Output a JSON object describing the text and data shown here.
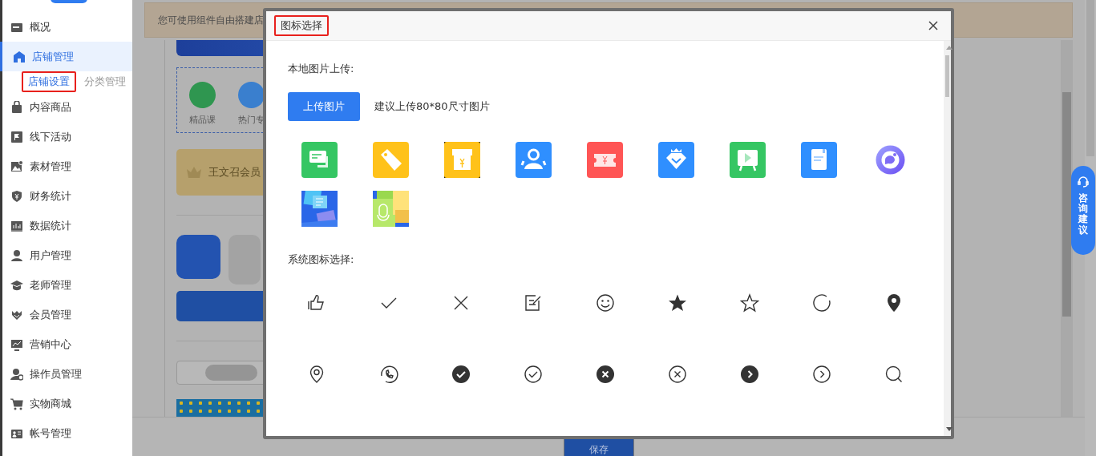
{
  "sidebar": {
    "items": [
      {
        "label": "概况",
        "selected": false
      },
      {
        "label": "店铺管理",
        "selected": true,
        "children": [
          {
            "label": "店铺设置",
            "selected": true,
            "annotated": true
          },
          {
            "label": "分类管理",
            "selected": false,
            "annotated": false
          }
        ]
      },
      {
        "label": "内容商品",
        "selected": false
      },
      {
        "label": "线下活动",
        "selected": false
      },
      {
        "label": "素材管理",
        "selected": false
      },
      {
        "label": "财务统计",
        "selected": false
      },
      {
        "label": "数据统计",
        "selected": false
      },
      {
        "label": "用户管理",
        "selected": false
      },
      {
        "label": "老师管理",
        "selected": false
      },
      {
        "label": "会员管理",
        "selected": false
      },
      {
        "label": "营销中心",
        "selected": false
      },
      {
        "label": "操作员管理",
        "selected": false
      },
      {
        "label": "实物商城",
        "selected": false
      },
      {
        "label": "帐号管理",
        "selected": false
      }
    ]
  },
  "background_page": {
    "notice": "您可使用组件自由搭建店",
    "shortcuts": [
      "精品课",
      "热门专"
    ],
    "member_card": "王文召会员",
    "save_button": "保存"
  },
  "consult_button": {
    "label": "咨询建议"
  },
  "dialog": {
    "title": "图标选择",
    "title_annotated": true,
    "upload_label": "本地图片上传:",
    "upload_button": "上传图片",
    "upload_hint": "建议上传80*80尺寸图片",
    "image_icons": [
      {
        "kind": "chat"
      },
      {
        "kind": "tag"
      },
      {
        "kind": "box"
      },
      {
        "kind": "people"
      },
      {
        "kind": "ticket"
      },
      {
        "kind": "diamond"
      },
      {
        "kind": "video"
      },
      {
        "kind": "document"
      },
      {
        "kind": "bubble"
      },
      {
        "kind": "files"
      },
      {
        "kind": "blocks"
      }
    ],
    "system_label": "系统图标选择:",
    "system_icons": [
      {
        "kind": "like"
      },
      {
        "kind": "check"
      },
      {
        "kind": "close"
      },
      {
        "kind": "edit"
      },
      {
        "kind": "smile"
      },
      {
        "kind": "star-filled"
      },
      {
        "kind": "star"
      },
      {
        "kind": "loading"
      },
      {
        "kind": "pin-filled"
      },
      {
        "kind": "pin"
      },
      {
        "kind": "phone"
      },
      {
        "kind": "check-circle-filled"
      },
      {
        "kind": "check-circle"
      },
      {
        "kind": "close-circle-filled"
      },
      {
        "kind": "close-circle"
      },
      {
        "kind": "arrow-circle-filled"
      },
      {
        "kind": "arrow-circle"
      },
      {
        "kind": "search"
      }
    ]
  }
}
